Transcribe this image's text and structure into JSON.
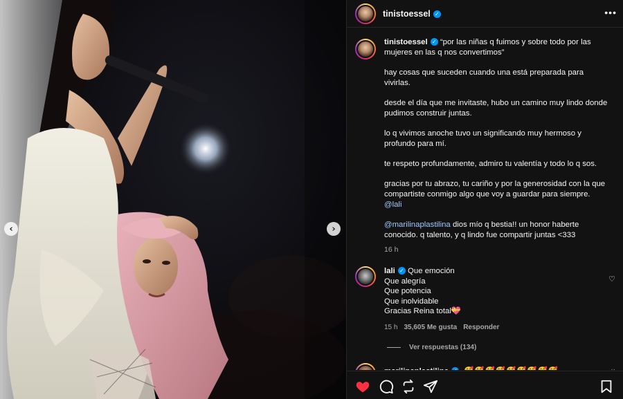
{
  "header": {
    "username": "tinistoessel",
    "more_label": "•••"
  },
  "caption": {
    "username": "tinistoessel",
    "paragraphs": [
      "“por las niñas q fuimos y sobre todo por las mujeres en las q nos convertimos”",
      "hay cosas que suceden cuando una está preparada para vivirlas.",
      "desde el día que me invitaste, hubo un camino muy lindo donde pudimos construir juntas.",
      "lo q vivimos anoche tuvo un significando muy hermoso y profundo para mí.",
      "te respeto profundamente, admiro tu valentía y todo lo q sos.",
      "gracias por tu abrazo, tu cariño y por la generosidad con la que compartiste conmigo algo que voy a guardar para siempre."
    ],
    "mention_1": "@lali",
    "mention_2": "@marilinaplastilina",
    "last_paragraph": "dios mío q bestia!! un honor haberte conocido. q talento, y q lindo fue compartir juntas <333",
    "time": "16 h"
  },
  "comment": {
    "username": "lali",
    "lines": [
      "Que emoción",
      "Que alegría",
      "Que potencia",
      "Que inolvidable",
      "Gracias Reina total💝"
    ],
    "time": "15 h",
    "likes": "35,605 Me gusta",
    "reply": "Responder",
    "view_replies": "Ver respuestas (134)"
  },
  "comment2": {
    "username": "marilinaplastilina",
    "emojis": "🥰🥰🥰🥰🥰🥰🥰🥰🥰",
    "dots": "··"
  },
  "icons": {
    "like": "heart-icon",
    "comment": "comment-icon",
    "repost": "repost-icon",
    "share": "share-icon",
    "save": "bookmark-icon",
    "prev": "chevron-left-icon",
    "next": "chevron-right-icon"
  },
  "colors": {
    "liked": "#ff3040",
    "verified": "#0095f6",
    "mention": "#a5c8ff"
  },
  "carousel": {
    "prev_glyph": "‹",
    "next_glyph": "›"
  }
}
